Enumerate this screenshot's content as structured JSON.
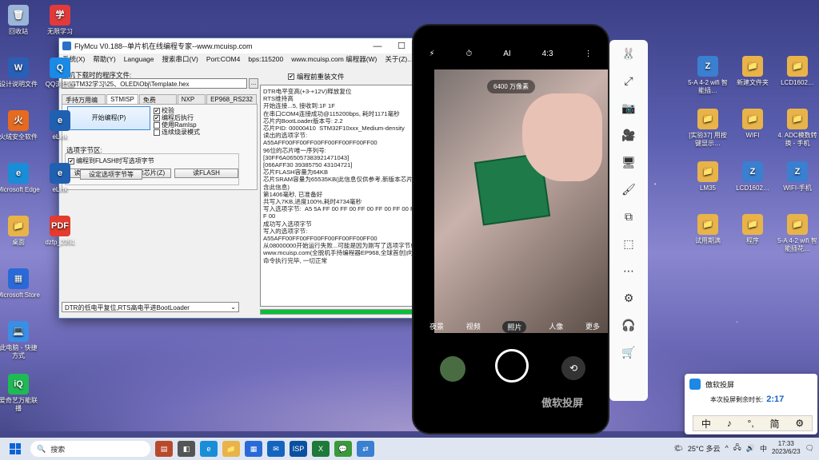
{
  "desktop": {
    "icons_col1": [
      {
        "label": "回收站",
        "color": "#9bb5d8",
        "glyph": "🗑"
      },
      {
        "label": "设计说明文件",
        "color": "#2a5fb6",
        "glyph": "W"
      },
      {
        "label": "火绒安全软件",
        "color": "#e56b21",
        "glyph": "火"
      },
      {
        "label": "Microsoft Edge",
        "color": "#1a8dd8",
        "glyph": "e"
      },
      {
        "label": "桌面",
        "color": "#e8b44a",
        "glyph": "📁"
      },
      {
        "label": "Microsoft Store",
        "color": "#2a6ad8",
        "glyph": "▦"
      },
      {
        "label": "此电脑 - 快捷方式",
        "color": "#3a8ee6",
        "glyph": "💻"
      },
      {
        "label": "爱奇艺万能联播",
        "color": "#1fb955",
        "glyph": "iQ"
      }
    ],
    "icons_col2": [
      {
        "label": "无限学习",
        "color": "#e23a3a",
        "glyph": "学"
      },
      {
        "label": "QQ浏览器",
        "color": "#1b8ae6",
        "glyph": "Q"
      },
      {
        "label": "eLink",
        "color": "#2060b0",
        "glyph": "e"
      },
      {
        "label": "eLink",
        "color": "#2060b0",
        "glyph": "e"
      },
      {
        "label": "dzfp_2351",
        "color": "#e33b2e",
        "glyph": "PDF"
      }
    ],
    "icons_right": [
      {
        "label": "5-A 4-2 wifi 智能插…",
        "color": "#3a7fd0",
        "glyph": "Z"
      },
      {
        "label": "新建文件夹",
        "color": "#e8b44a",
        "glyph": "📁"
      },
      {
        "label": "LCD1602…",
        "color": "#e8b44a",
        "glyph": "📁"
      },
      {
        "label": "[实验37] 用按键显示…",
        "color": "#e8b44a",
        "glyph": "📁"
      },
      {
        "label": "WIFI",
        "color": "#e8b44a",
        "glyph": "📁"
      },
      {
        "label": "4. ADC模数转换 - 手机",
        "color": "#e8b44a",
        "glyph": "📁"
      },
      {
        "label": "LM35",
        "color": "#e8b44a",
        "glyph": "📁"
      },
      {
        "label": "LCD1602…",
        "color": "#3a7fd0",
        "glyph": "Z"
      },
      {
        "label": "WIFI-手机",
        "color": "#3a7fd0",
        "glyph": "Z"
      },
      {
        "label": "试用期满",
        "color": "#e8b44a",
        "glyph": "📁"
      },
      {
        "label": "程序",
        "color": "#e8b44a",
        "glyph": "📁"
      },
      {
        "label": "5-A 4-2 wifi 智能插花…",
        "color": "#e8b44a",
        "glyph": "📁"
      }
    ]
  },
  "flymcu": {
    "title": "FlyMcu V0.188--单片机在线编程专家--www.mcuisp.com",
    "menu": [
      "系统(X)",
      "帮助(Y)",
      "Language",
      "搜索串口(V)",
      "Port:COM4",
      "bps:115200",
      "www.mcuisp.com 编程器(W)",
      "关于(Z)..."
    ],
    "file_label": "联机下载时的程序文件:",
    "file_path": "F:\\STM32学习\\25、OLED\\Obj\\Template.hex",
    "browse": "...",
    "reload_checkbox": "编程前重装文件",
    "tabs": [
      "手持万用编程器",
      "STMISP",
      "免费STMIAP",
      "NXP ISP",
      "EP968_RS232"
    ],
    "start_button": "开始编程(P)",
    "options": [
      "校验",
      "编程后执行",
      "使用RamIsp",
      "连续烧录模式"
    ],
    "read_button": "读器件信息(R)",
    "erase_button": "清除芯片(Z)",
    "readflash_button": "读FLASH",
    "option_area_label": "选项字节区:",
    "option_write_checkbox": "编程到FLASH时写选项字节",
    "option_set_button": "设定选项字节等",
    "status_select": "DTR的低电平复位,RTS高电平进BootLoader",
    "log": "DTR电平变高(+3-+12V)释放复位\nRTS维持高\n开始连接...5, 接收到:1F 1F\n在串口COM4连接成功@115200bps, 耗时1171毫秒\n芯片内BootLoader版本号: 2.2\n芯片PID: 00000410  STM32F10xxx_Medium-density\n读出的选项字节:\nA55AFF00FF00FF00FF00FF00FF00FF00\n96位的芯片唯一序列号:\n[30FF6A065057383921471043]\n[066AFF30 39385750 43104721]\n芯片FLASH容量为64KB\n芯片SRAM容量为65535KB(此信息仅供参考,新版本芯片已不包含此信息)\n第1406毫秒, 已准备好\n共写入7KB,进度100%,耗时4734毫秒\n写入选项字节:  A5 5A FF 00 FF 00 FF 00 FF 00 FF 00 FF 00 FF 00\n成功写入选项字节\n写入的选项字节:\nA55AFF00FF00FF00FF00FF00FF00FF00\n从08000000开始运行失败...可能是因为刚写了选项字节!!!\nwww.mcuisp.com(全脱机手持编程器EP968,全球首创)向您报告, 命令执行完毕, 一切正常",
    "progress_percent": 100
  },
  "phone": {
    "pixel_badge": "6400 万像素",
    "top_icons": [
      "⚡",
      "⏱",
      "AI",
      "4:3",
      "⋮"
    ],
    "modes": [
      "夜景",
      "视频",
      "照片",
      "人像",
      "更多"
    ],
    "active_mode": "照片",
    "watermark": "傲软投屏"
  },
  "popup": {
    "title": "傲软投屏",
    "remain_label": "本次投屏剩余时长:",
    "remain_value": "2:17"
  },
  "ime": [
    "中",
    "♪",
    "°,",
    "简",
    "⚙"
  ],
  "taskbar": {
    "search_placeholder": "搜索",
    "weather": "25°C 多云",
    "ime_label": "中",
    "time": "17:33",
    "date": "2023/6/23"
  }
}
